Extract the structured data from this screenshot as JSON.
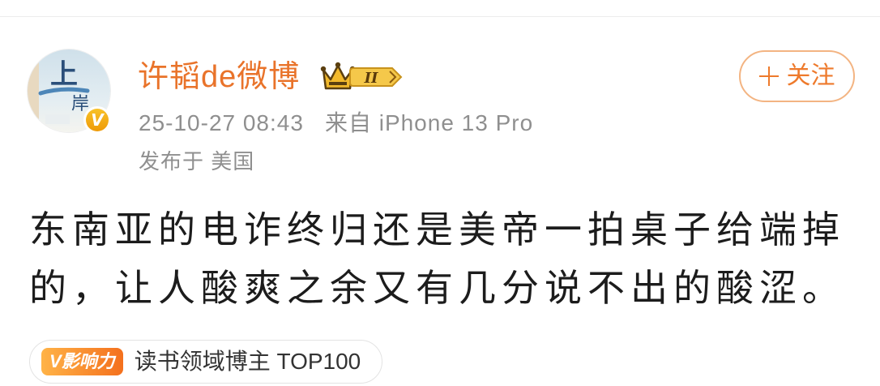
{
  "user": {
    "name": "许韬de微博",
    "member_level": "II",
    "verified_mark": "V",
    "avatar": {
      "text_top": "上",
      "text_bottom": "岸"
    }
  },
  "actions": {
    "follow_label": "关注"
  },
  "post": {
    "timestamp": "25-10-27 08:43",
    "source": "来自 iPhone 13 Pro",
    "location": "发布于 美国",
    "text": "东南亚的电诈终归还是美帝一拍桌子给端掉的，让人酸爽之余又有几分说不出的酸涩。"
  },
  "tag": {
    "badge": "V影响力",
    "label": "读书领域博主 TOP100"
  },
  "icons": [
    "plus-icon",
    "crown-icon",
    "verified-v-icon",
    "avatar-image"
  ],
  "colors": {
    "username": "#e9732a",
    "accent": "#ee7a2c",
    "follow_border": "#f3b482",
    "meta_text": "#8f8f8f",
    "body_text": "#1c1c1c",
    "verified_gold": "#f2ac14"
  }
}
